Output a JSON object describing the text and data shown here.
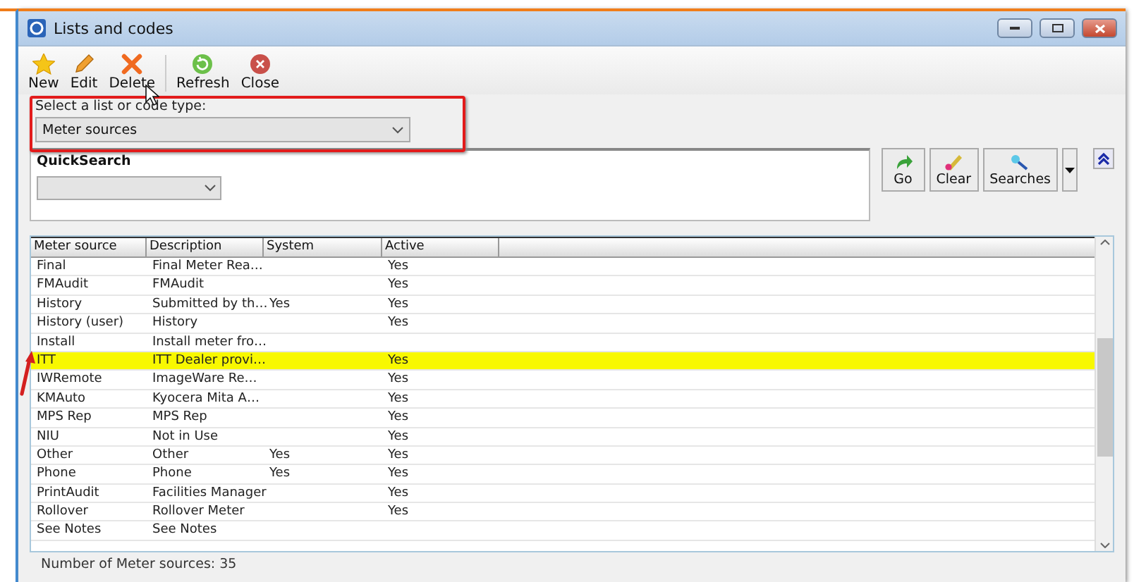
{
  "window": {
    "title": "Lists and codes"
  },
  "toolbar": [
    {
      "label": "New",
      "kind": "star"
    },
    {
      "label": "Edit",
      "kind": "pencil"
    },
    {
      "label": "Delete",
      "kind": "cross"
    },
    {
      "label": "Refresh",
      "kind": "refresh"
    },
    {
      "label": "Close",
      "kind": "close"
    }
  ],
  "list_type": {
    "label": "Select a list or code type:",
    "value": "Meter sources"
  },
  "quick_search": {
    "title": "QuickSearch"
  },
  "search_buttons": [
    {
      "label": "Go",
      "kind": "go"
    },
    {
      "label": "Clear",
      "kind": "clear"
    },
    {
      "label": "Searches",
      "kind": "searches"
    }
  ],
  "table": {
    "columns": [
      "Meter source",
      "Description",
      "System",
      "Active"
    ],
    "rows": [
      {
        "cells": [
          "Final",
          "Final Meter Rea…",
          "",
          "Yes"
        ],
        "highlighted": false
      },
      {
        "cells": [
          "FMAudit",
          "FMAudit",
          "",
          "Yes"
        ],
        "highlighted": false
      },
      {
        "cells": [
          "History",
          "Submitted by th…",
          "Yes",
          "Yes"
        ],
        "highlighted": false
      },
      {
        "cells": [
          "History (user)",
          "History",
          "",
          "Yes"
        ],
        "highlighted": false
      },
      {
        "cells": [
          "Install",
          "Install meter fro…",
          "",
          ""
        ],
        "highlighted": false
      },
      {
        "cells": [
          "ITT",
          "ITT Dealer provi…",
          "",
          "Yes"
        ],
        "highlighted": true
      },
      {
        "cells": [
          "IWRemote",
          "ImageWare Re…",
          "",
          "Yes"
        ],
        "highlighted": false
      },
      {
        "cells": [
          "KMAuto",
          "Kyocera Mita A…",
          "",
          "Yes"
        ],
        "highlighted": false
      },
      {
        "cells": [
          "MPS Rep",
          "MPS Rep",
          "",
          "Yes"
        ],
        "highlighted": false
      },
      {
        "cells": [
          "NIU",
          "Not in Use",
          "",
          "Yes"
        ],
        "highlighted": false
      },
      {
        "cells": [
          "Other",
          "Other",
          "Yes",
          "Yes"
        ],
        "highlighted": false
      },
      {
        "cells": [
          "Phone",
          "Phone",
          "Yes",
          "Yes"
        ],
        "highlighted": false
      },
      {
        "cells": [
          "PrintAudit",
          "Facilities Manager",
          "",
          "Yes"
        ],
        "highlighted": false
      },
      {
        "cells": [
          "Rollover",
          "Rollover Meter",
          "",
          "Yes"
        ],
        "highlighted": false
      },
      {
        "cells": [
          "See Notes",
          "See Notes",
          "",
          ""
        ],
        "highlighted": false
      }
    ]
  },
  "status_bar": "Number of Meter sources: 35"
}
